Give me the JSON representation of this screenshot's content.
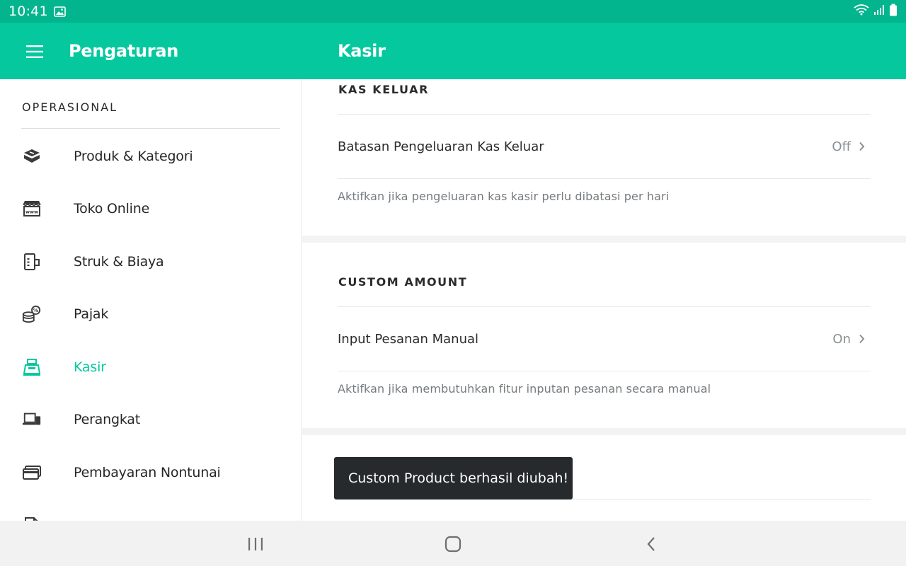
{
  "status_bar": {
    "time": "10:41"
  },
  "app_bar": {
    "left_title": "Pengaturan",
    "right_title": "Kasir"
  },
  "sidebar": {
    "section_title": "OPERASIONAL",
    "items": [
      {
        "label": "Produk & Kategori",
        "icon": "box-icon"
      },
      {
        "label": "Toko Online",
        "icon": "store-www-icon"
      },
      {
        "label": "Struk & Biaya",
        "icon": "receipt-icon"
      },
      {
        "label": "Pajak",
        "icon": "coins-percent-icon"
      },
      {
        "label": "Kasir",
        "icon": "cashier-icon",
        "active": true
      },
      {
        "label": "Perangkat",
        "icon": "devices-icon"
      },
      {
        "label": "Pembayaran Nontunai",
        "icon": "card-icon"
      }
    ]
  },
  "content": {
    "kas_keluar": {
      "header": "KAS KELUAR",
      "row_label": "Batasan Pengeluaran Kas Keluar",
      "row_value": "Off",
      "description": "Aktifkan jika pengeluaran kas kasir perlu dibatasi per hari"
    },
    "custom_amount": {
      "header": "CUSTOM AMOUNT",
      "row_label": "Input Pesanan Manual",
      "row_value": "On",
      "description": "Aktifkan jika membutuhkan fitur inputan pesanan secara manual"
    }
  },
  "toast": {
    "message": "Custom Product berhasil diubah!"
  },
  "colors": {
    "accent": "#05c89e",
    "status_bar": "#03b58e",
    "toast_bg": "#262a2c"
  }
}
